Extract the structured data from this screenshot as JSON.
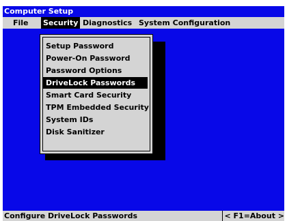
{
  "window": {
    "title": "Computer Setup"
  },
  "menu": {
    "items": [
      {
        "label": "File",
        "active": false
      },
      {
        "label": "Security",
        "active": true
      },
      {
        "label": "Diagnostics",
        "active": false
      },
      {
        "label": "System Configuration",
        "active": false
      }
    ]
  },
  "security_menu": {
    "items": [
      "Setup Password",
      "Power-On Password",
      "Password Options",
      "DriveLock Passwords",
      "Smart Card Security",
      "TPM Embedded Security",
      "System IDs",
      "Disk Sanitizer"
    ],
    "selected": "DriveLock Passwords"
  },
  "status": {
    "description": "Configure DriveLock Passwords",
    "hint": "< F1=About >"
  },
  "colors": {
    "background": "#0808e8",
    "menu_gray": "#d4d4d4",
    "highlight": "#000000"
  }
}
